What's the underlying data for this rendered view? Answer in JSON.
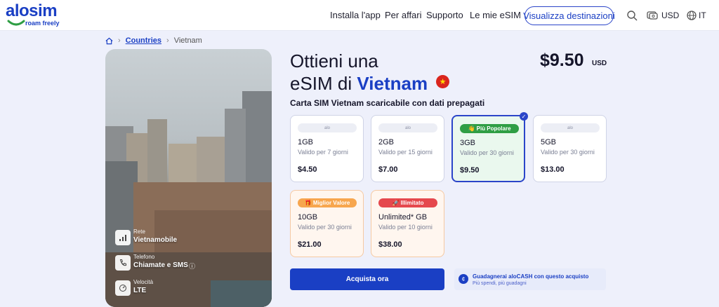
{
  "brand": {
    "name": "alosim",
    "tagline": "roam freely",
    "color": "#1a3fc4"
  },
  "nav": {
    "items": [
      "Installa l'app",
      "Per affari",
      "Supporto",
      "Le mie eSIM"
    ],
    "cta": "Visualizza destinazioni",
    "currency": "USD",
    "language": "IT",
    "icons": [
      "search-icon",
      "currency-icon",
      "globe-icon"
    ]
  },
  "breadcrumb": {
    "home_icon": "home-icon",
    "countries": "Countries",
    "current": "Vietnam"
  },
  "hero": {
    "title_line1": "Ottieni una",
    "title_line2_prefix": "eSIM di",
    "title_line2_country": "Vietnam",
    "flag_icon": "vietnam-flag-icon",
    "price": "$9.50",
    "price_currency": "USD",
    "subtitle": "Carta SIM Vietnam scaricabile con dati prepagati"
  },
  "specs": [
    {
      "label": "Rete",
      "value": "Vietnamobile",
      "icon": "signal-icon"
    },
    {
      "label": "Telefono",
      "value": "Chiamate e SMS",
      "icon": "phone-icon",
      "info_icon": "info-icon"
    },
    {
      "label": "Velocità",
      "value": "LTE",
      "icon": "speed-icon"
    }
  ],
  "plans": [
    {
      "badge": "alo",
      "data": "1GB",
      "validity": "Valido per 7 giorni",
      "price": "$4.50"
    },
    {
      "badge": "alo",
      "data": "2GB",
      "validity": "Valido per 15 giorni",
      "price": "$7.00"
    },
    {
      "badge": "👋 Più Popolare",
      "data": "3GB",
      "validity": "Valido per 30 giorni",
      "price": "$9.50",
      "selected": true
    },
    {
      "badge": "alo",
      "data": "5GB",
      "validity": "Valido per 30 giorni",
      "price": "$13.00"
    },
    {
      "badge": "🎁 Miglior Valore",
      "data": "10GB",
      "validity": "Valido per 30 giorni",
      "price": "$21.00"
    },
    {
      "badge": "🚀 Illimitato",
      "data": "Unlimited* GB",
      "validity": "Valido per 10 giorni",
      "price": "$38.00"
    }
  ],
  "buy": {
    "button": "Acquista ora",
    "cash_title": "Guadagnerai aloCASH con questo acquisto",
    "cash_sub": "Più spendi, più guadagni"
  },
  "colors": {
    "accent": "#1a3fc4",
    "popular": "#2f9e44",
    "best_value": "#f7a64e",
    "unlimited": "#e5484d",
    "background": "#eef0fb"
  }
}
